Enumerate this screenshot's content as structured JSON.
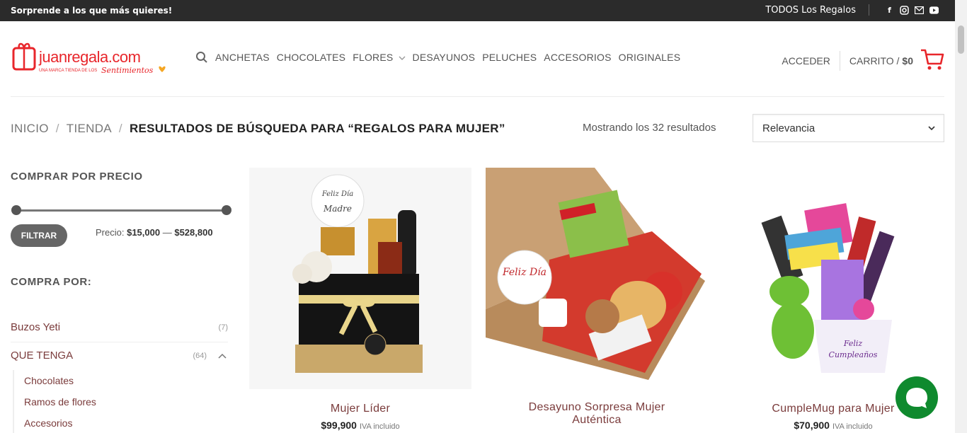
{
  "topbar": {
    "promo": "Sorprende a los que más quieres!",
    "all_gifts": "TODOS Los Regalos",
    "social": [
      "facebook-icon",
      "instagram-icon",
      "email-icon",
      "youtube-icon"
    ]
  },
  "header": {
    "logo_main": "juanregala.com",
    "logo_sub": "UNA MARCA TIENDA DE LOS",
    "logo_script": "Sentimientos",
    "nav": [
      "ANCHETAS",
      "CHOCOLATES",
      "FLORES",
      "DESAYUNOS",
      "PELUCHES",
      "ACCESORIOS",
      "ORIGINALES"
    ],
    "login": "ACCEDER",
    "cart_label": "CARRITO /",
    "cart_amount": "$0"
  },
  "breadcrumb": {
    "home": "INICIO",
    "shop": "TIENDA",
    "current": "RESULTADOS DE BÚSQUEDA PARA “REGALOS PARA MUJER”",
    "divider": "/"
  },
  "results": {
    "count_text": "Mostrando los 32 resultados",
    "sort_value": "Relevancia"
  },
  "sidebar": {
    "price_title": "COMPRAR POR PRECIO",
    "filter_label": "FILTRAR",
    "price_label": "Precio:",
    "price_min": "$15,000",
    "price_sep": "—",
    "price_max": "$528,800",
    "shop_by_title": "COMPRA POR:",
    "categories": [
      {
        "label": "Buzos Yeti",
        "count": "(7)"
      },
      {
        "label": "QUE TENGA",
        "count": "(64)"
      }
    ],
    "subcategories": [
      "Chocolates",
      "Ramos de flores",
      "Accesorios"
    ]
  },
  "products": [
    {
      "name": "Mujer Líder",
      "price": "$99,900",
      "tax": "IVA incluido",
      "tag": "Feliz Día de la Madre"
    },
    {
      "name": "Desayuno Sorpresa Mujer",
      "name2": "Auténtica",
      "price": "",
      "tax": "",
      "tag": "Feliz Día"
    },
    {
      "name": "CumpleMug para Mujer",
      "price": "$70,900",
      "tax": "IVA incluido",
      "tag": "Feliz Cumpleaños"
    }
  ],
  "colors": {
    "accent": "#e8262b",
    "link": "#7a3b3b",
    "chat": "#0f8a2e"
  }
}
